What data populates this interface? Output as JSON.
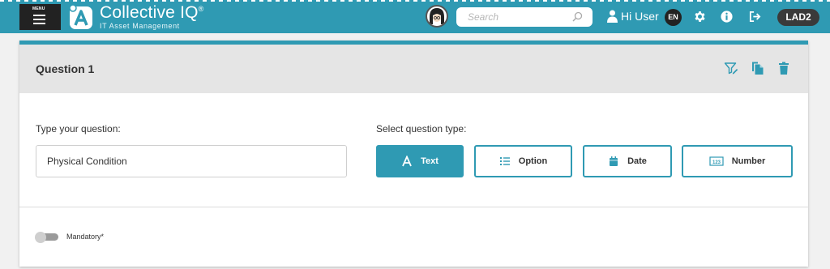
{
  "header": {
    "menu_label": "MENU",
    "brand": {
      "name": "Collective IQ",
      "trademark": "®",
      "tagline": "IT Asset Management"
    },
    "search": {
      "placeholder": "Search",
      "value": ""
    },
    "greeting": "Hi User",
    "language": "EN",
    "profile_badge": "LAD2",
    "icons": {
      "menu": "hamburger-icon",
      "logo": "collective-iq-logo",
      "search": "search-icon",
      "user": "user-icon",
      "settings": "gear-icon",
      "info": "info-icon",
      "logout": "logout-icon"
    },
    "colors": {
      "topbar": "#2f9ab3",
      "menu_bg": "#222222",
      "badge_bg": "#3a3a3a"
    }
  },
  "question_card": {
    "title": "Question 1",
    "header_actions": [
      {
        "name": "filter-edit-icon"
      },
      {
        "name": "copy-icon"
      },
      {
        "name": "delete-icon"
      }
    ],
    "question_label": "Type your question:",
    "question_value": "Physical Condition",
    "type_label": "Select question type:",
    "types": [
      {
        "label": "Text",
        "icon": "text-type-icon",
        "active": true
      },
      {
        "label": "Option",
        "icon": "list-icon",
        "active": false
      },
      {
        "label": "Date",
        "icon": "calendar-icon",
        "active": false
      },
      {
        "label": "Number",
        "icon": "number-icon",
        "active": false
      }
    ],
    "mandatory_label": "Mandatory*",
    "mandatory_on": false,
    "accent_color": "#2f9ab3"
  }
}
